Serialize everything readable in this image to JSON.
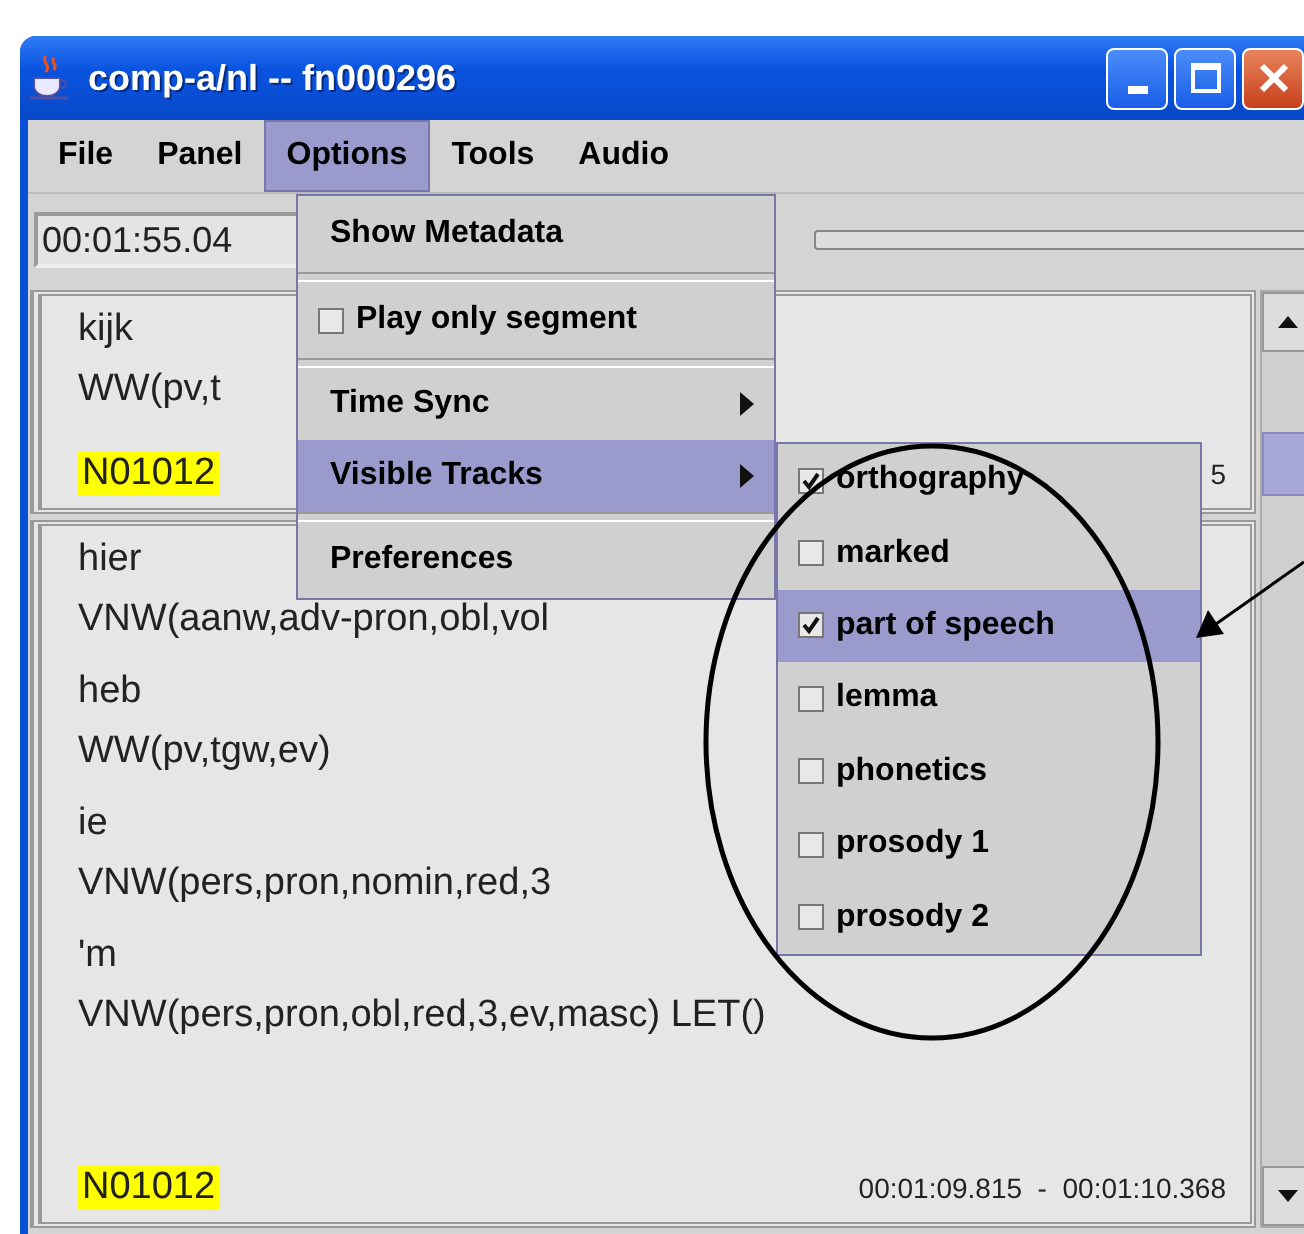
{
  "window": {
    "title": "comp-a/nl -- fn000296"
  },
  "menubar": [
    {
      "label": "File",
      "selected": false
    },
    {
      "label": "Panel",
      "selected": false
    },
    {
      "label": "Options",
      "selected": true
    },
    {
      "label": "Tools",
      "selected": false
    },
    {
      "label": "Audio",
      "selected": false
    }
  ],
  "toolbar": {
    "time": "00:01:55.04"
  },
  "segments": [
    {
      "tokens": [
        {
          "word": "kijk",
          "tag": "WW(pv,t"
        }
      ],
      "id": "N01012",
      "time": "5"
    },
    {
      "tokens": [
        {
          "word": "hier",
          "tag": "VNW(aanw,adv-pron,obl,vol"
        },
        {
          "word": "heb",
          "tag": "WW(pv,tgw,ev)"
        },
        {
          "word": "ie",
          "tag": "VNW(pers,pron,nomin,red,3"
        },
        {
          "word": "'m",
          "tag": "VNW(pers,pron,obl,red,3,ev,masc) LET()"
        }
      ],
      "id": "N01012",
      "time": "00:01:09.815  -  00:01:10.368"
    }
  ],
  "options_menu": {
    "items": [
      {
        "kind": "action",
        "label": "Show Metadata",
        "selected": false
      },
      {
        "kind": "separator"
      },
      {
        "kind": "check",
        "label": "Play only segment",
        "checked": false,
        "selected": false
      },
      {
        "kind": "separator"
      },
      {
        "kind": "submenu",
        "label": "Time Sync",
        "selected": false
      },
      {
        "kind": "submenu",
        "label": "Visible Tracks",
        "selected": true
      },
      {
        "kind": "separator"
      },
      {
        "kind": "action",
        "label": "Preferences",
        "selected": false
      }
    ]
  },
  "tracks_menu": {
    "items": [
      {
        "label": "orthography",
        "checked": true,
        "selected": false
      },
      {
        "label": "marked",
        "checked": false,
        "selected": false
      },
      {
        "label": "part of speech",
        "checked": true,
        "selected": true
      },
      {
        "label": "lemma",
        "checked": false,
        "selected": false
      },
      {
        "label": "phonetics",
        "checked": false,
        "selected": false
      },
      {
        "label": "prosody 1",
        "checked": false,
        "selected": false
      },
      {
        "label": "prosody 2",
        "checked": false,
        "selected": false
      }
    ]
  }
}
